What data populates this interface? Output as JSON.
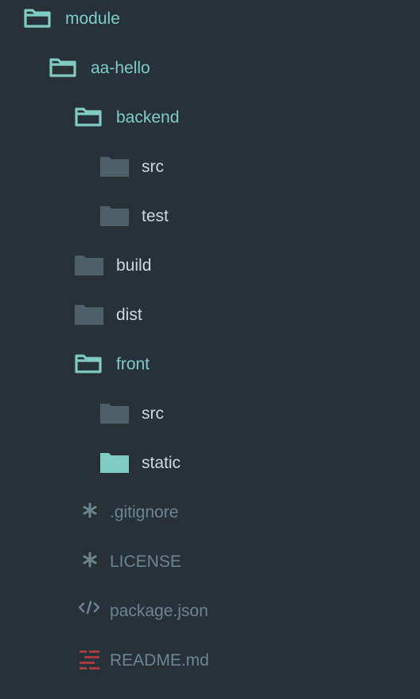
{
  "colors": {
    "background": "#263238",
    "accent": "#80cbc4",
    "folder_closed": "#4d5f69",
    "folder_open_text": "#80cbc4",
    "folder_text": "#cfd8dc",
    "file_text": "#6c8592",
    "file_icon": "#6c8592",
    "readme_icon": "#a33a3f"
  },
  "tree": [
    {
      "label": "module",
      "kind": "folder",
      "state": "open",
      "icon": "folder-open-icon"
    },
    {
      "label": "aa-hello",
      "kind": "folder",
      "state": "open",
      "icon": "folder-open-icon"
    },
    {
      "label": "backend",
      "kind": "folder",
      "state": "open",
      "icon": "folder-open-icon"
    },
    {
      "label": "src",
      "kind": "folder",
      "state": "closed",
      "icon": "folder-icon"
    },
    {
      "label": "test",
      "kind": "folder",
      "state": "closed",
      "icon": "folder-icon"
    },
    {
      "label": "build",
      "kind": "folder",
      "state": "closed",
      "icon": "folder-icon"
    },
    {
      "label": "dist",
      "kind": "folder",
      "state": "closed",
      "icon": "folder-icon"
    },
    {
      "label": "front",
      "kind": "folder",
      "state": "open",
      "icon": "folder-open-icon"
    },
    {
      "label": "src",
      "kind": "folder",
      "state": "closed",
      "icon": "folder-icon"
    },
    {
      "label": "static",
      "kind": "folder",
      "state": "closed-highlight",
      "icon": "folder-filled-icon"
    },
    {
      "label": ".gitignore",
      "kind": "file",
      "icon": "asterisk-icon"
    },
    {
      "label": "LICENSE",
      "kind": "file",
      "icon": "asterisk-icon"
    },
    {
      "label": "package.json",
      "kind": "file",
      "icon": "code-icon"
    },
    {
      "label": "README.md",
      "kind": "file",
      "icon": "readme-icon"
    }
  ]
}
